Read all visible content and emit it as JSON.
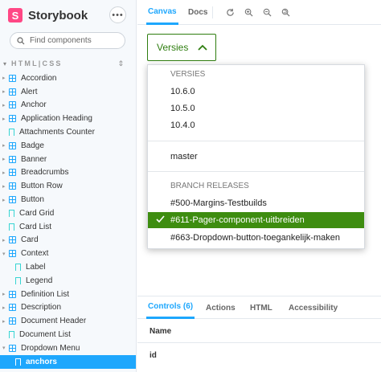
{
  "app": {
    "name": "Storybook",
    "logo_letter": "S",
    "menu_glyph": "•••"
  },
  "search": {
    "placeholder": "Find components"
  },
  "sidebar": {
    "section": "HTML|CSS",
    "items": [
      {
        "label": "Accordion",
        "type": "component",
        "depth": 0
      },
      {
        "label": "Alert",
        "type": "component",
        "depth": 0
      },
      {
        "label": "Anchor",
        "type": "component",
        "depth": 0
      },
      {
        "label": "Application Heading",
        "type": "component",
        "depth": 0
      },
      {
        "label": "Attachments Counter",
        "type": "story",
        "depth": 0
      },
      {
        "label": "Badge",
        "type": "component",
        "depth": 0
      },
      {
        "label": "Banner",
        "type": "component",
        "depth": 0
      },
      {
        "label": "Breadcrumbs",
        "type": "component",
        "depth": 0
      },
      {
        "label": "Button Row",
        "type": "component",
        "depth": 0
      },
      {
        "label": "Button",
        "type": "component",
        "depth": 0
      },
      {
        "label": "Card Grid",
        "type": "story",
        "depth": 0
      },
      {
        "label": "Card List",
        "type": "story",
        "depth": 0
      },
      {
        "label": "Card",
        "type": "component",
        "depth": 0
      },
      {
        "label": "Context",
        "type": "component",
        "depth": 0,
        "expanded": true
      },
      {
        "label": "Label",
        "type": "story",
        "depth": 1
      },
      {
        "label": "Legend",
        "type": "story",
        "depth": 1
      },
      {
        "label": "Definition List",
        "type": "component",
        "depth": 0
      },
      {
        "label": "Description",
        "type": "component",
        "depth": 0
      },
      {
        "label": "Document Header",
        "type": "component",
        "depth": 0
      },
      {
        "label": "Document List",
        "type": "story",
        "depth": 0
      },
      {
        "label": "Dropdown Menu",
        "type": "component",
        "depth": 0,
        "expanded": true
      },
      {
        "label": "anchors",
        "type": "story",
        "depth": 1,
        "selected": true
      }
    ]
  },
  "toolbar": {
    "tabs": [
      {
        "label": "Canvas",
        "active": true
      },
      {
        "label": "Docs",
        "active": false
      }
    ],
    "tools": [
      "refresh-icon",
      "zoom-in-icon",
      "zoom-out-icon",
      "zoom-reset-icon"
    ]
  },
  "canvas": {
    "versions_button": "Versies",
    "dropdown": {
      "group_versions": "VERSIES",
      "versions": [
        "10.6.0",
        "10.5.0",
        "10.4.0"
      ],
      "master": "master",
      "group_branches": "BRANCH RELEASES",
      "branches": [
        {
          "label": "#500-Margins-Testbuilds",
          "selected": false
        },
        {
          "label": "#611-Pager-component-uitbreiden",
          "selected": true
        },
        {
          "label": "#663-Dropdown-button-toegankelijk-maken",
          "selected": false
        }
      ]
    }
  },
  "panel": {
    "tabs": [
      {
        "label": "Controls (6)",
        "active": true
      },
      {
        "label": "Actions",
        "active": false
      },
      {
        "label": "HTML",
        "active": false
      },
      {
        "label": "Accessibility",
        "active": false
      }
    ],
    "column_name": "Name",
    "first_row": "id"
  },
  "colors": {
    "accent": "#1ea7fd",
    "brand": "#ff4785",
    "version_green": "#2e7d0f",
    "selected_green": "#3e8d10"
  }
}
